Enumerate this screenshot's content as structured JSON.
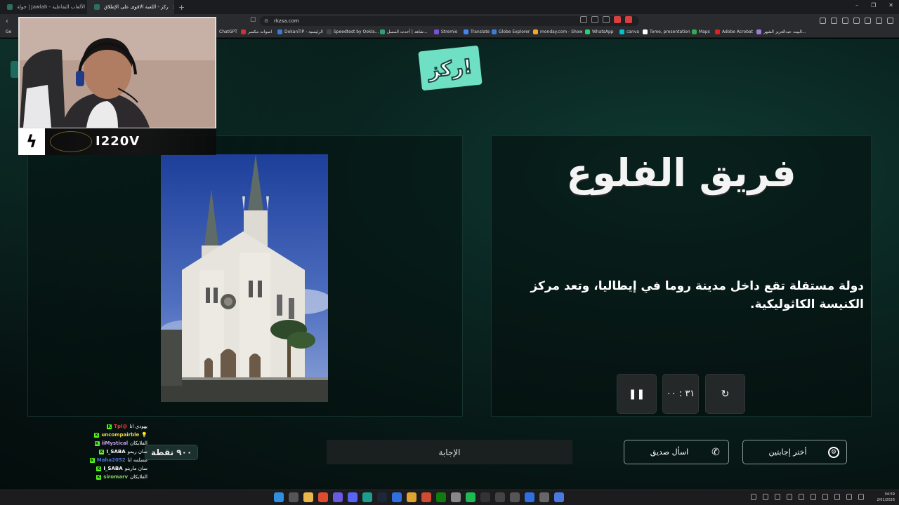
{
  "browser": {
    "tabs": [
      {
        "label": "جولة | Jawlah - منصة الألعاب التفاعلية",
        "active": false
      },
      {
        "label": "ركز - اللعبة الاقوى على الإطلاق",
        "active": true
      }
    ],
    "new_tab": "+",
    "url": "rkzsa.com",
    "bookmarks": [
      "Ge",
      "ChatGPT",
      "اصوات مكسر",
      "DokanTIP - الرئيسية",
      "Speedtest by Ookla...",
      "شاهد | أحدث المسل...",
      "Stremio",
      "Translate",
      "Globe Explorer",
      "monday.com - Show",
      "WhatsApp",
      "canva",
      "Tome, presentation",
      "Maps",
      "Adobe Acrobat",
      "البيت عبدالعزيز الشهر..."
    ],
    "window_controls": [
      "–",
      "❐",
      "✕"
    ]
  },
  "game": {
    "logo_text": "ركز!",
    "team_name": "فريق الفلوع",
    "question": "دولة مستقلة تقع داخل مدينة روما في إيطاليا، وتعد مركز الكنيسة الكاثوليكية.",
    "timer": "٣١ : ٠٠",
    "controls": {
      "pause_icon": "pause-icon",
      "reset_icon": "reset-icon"
    },
    "points": "٩٠٠ نقطة",
    "answer_button": "الإجابة",
    "ask_friend_button": "اسأل صديق",
    "choose_two_button": "أختر إجابتين"
  },
  "stream": {
    "streamer_name": "I220V",
    "chat": [
      {
        "user": "Tpl@",
        "user_color": "#e33b3b",
        "msg": "يهودي انا"
      },
      {
        "user": "uncompairble",
        "user_color": "#f3d34a",
        "msg": "💡"
      },
      {
        "user": "iiMystical",
        "user_color": "#c79be8",
        "msg": "الفلايكان"
      },
      {
        "user": "I_SABA",
        "user_color": "#ffffff",
        "msg": "سان ريمو"
      },
      {
        "user": "Maha2052",
        "user_color": "#4a6fd8",
        "msg": "مسلمه انا"
      },
      {
        "user": "I_SABA",
        "user_color": "#ffffff",
        "msg": "سان مارينو"
      },
      {
        "user": "siromarv",
        "user_color": "#8bd36b",
        "msg": "الفلايكان"
      }
    ]
  },
  "taskbar": {
    "time": "04:59",
    "date": "2/01/2026"
  },
  "colors": {
    "page_bg": "#061513",
    "accent": "#6fe0c3",
    "kick_green": "#53fc18"
  }
}
